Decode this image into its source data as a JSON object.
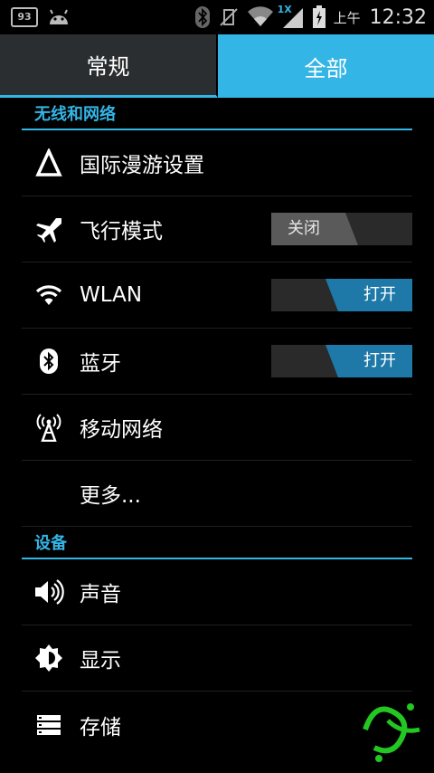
{
  "status_bar": {
    "notif_count": "93",
    "ampm": "上午",
    "time": "12:32",
    "signal_badge": "1X"
  },
  "tabs": [
    {
      "label": "常规",
      "selected": false
    },
    {
      "label": "全部",
      "selected": true
    }
  ],
  "sections": [
    {
      "title": "无线和网络",
      "items": [
        {
          "label": "国际漫游设置",
          "icon": "triangle-icon"
        },
        {
          "label": "飞行模式",
          "icon": "airplane-icon",
          "toggle": "关闭",
          "toggle_on": false
        },
        {
          "label": "WLAN",
          "icon": "wifi-icon",
          "toggle": "打开",
          "toggle_on": true
        },
        {
          "label": "蓝牙",
          "icon": "bluetooth-icon",
          "toggle": "打开",
          "toggle_on": true
        },
        {
          "label": "移动网络",
          "icon": "antenna-icon"
        },
        {
          "label": "更多...",
          "icon": null
        }
      ]
    },
    {
      "title": "设备",
      "items": [
        {
          "label": "声音",
          "icon": "speaker-icon"
        },
        {
          "label": "显示",
          "icon": "brightness-icon"
        },
        {
          "label": "存储",
          "icon": "storage-icon"
        }
      ]
    }
  ],
  "colors": {
    "accent": "#33b5e5",
    "switch_on": "#1e79a8"
  }
}
